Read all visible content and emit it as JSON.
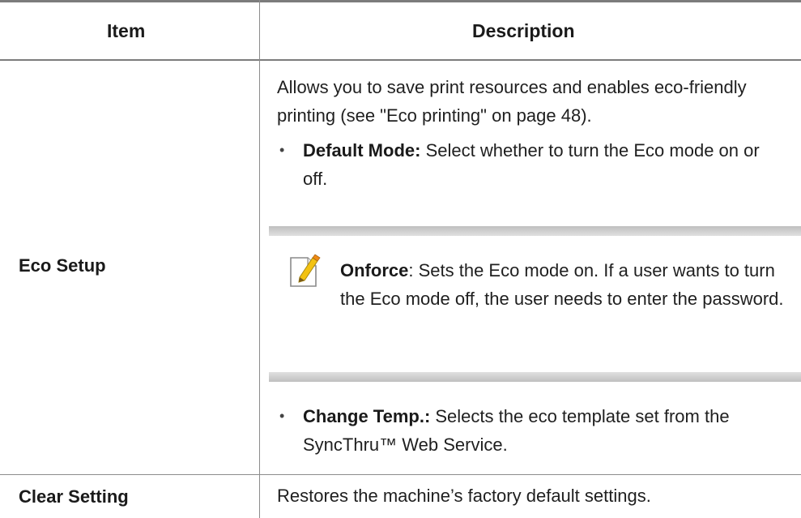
{
  "table": {
    "headers": {
      "item": "Item",
      "description": "Description"
    },
    "rows": [
      {
        "item": "Eco Setup",
        "intro": "Allows you to save print resources and enables eco-friendly printing (see \"Eco printing\" on page 48).",
        "bullets": [
          {
            "term": "Default Mode:",
            "text": " Select whether to turn the Eco mode on or off."
          }
        ],
        "note": {
          "icon": "note-pencil-icon",
          "term": "Onforce",
          "text": ": Sets the Eco mode on. If a user wants to turn the Eco mode off, the user needs to enter the password."
        },
        "bullets_after": [
          {
            "term": "Change Temp.:",
            "text": " Selects the eco template set from the SyncThru™ Web Service."
          }
        ]
      },
      {
        "item": "Clear Setting",
        "description": "Restores the machine’s factory default settings."
      }
    ]
  }
}
